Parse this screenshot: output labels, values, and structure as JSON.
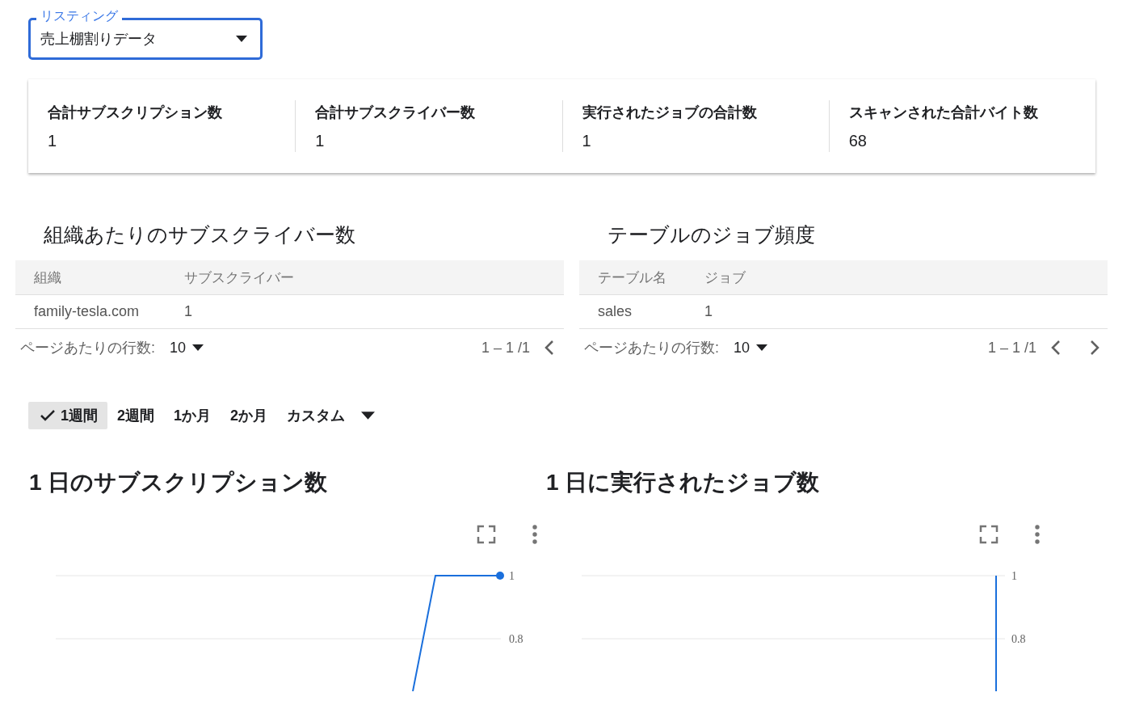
{
  "listing": {
    "label": "リスティング",
    "value": "売上棚割りデータ"
  },
  "summary": [
    {
      "label": "合計サブスクリプション数",
      "value": "1"
    },
    {
      "label": "合計サブスクライバー数",
      "value": "1"
    },
    {
      "label": "実行されたジョブの合計数",
      "value": "1"
    },
    {
      "label": "スキャンされた合計バイト数",
      "value": "68"
    }
  ],
  "tables": [
    {
      "title": "組織あたりのサブスクライバー数",
      "columns": [
        "組織",
        "サブスクライバー"
      ],
      "rows": [
        [
          "family-tesla.com",
          "1"
        ]
      ],
      "paginator": {
        "label": "ページあたりの行数:",
        "page_size": "10",
        "range": "1 – 1 /1",
        "prev_button": true,
        "next_button": false
      }
    },
    {
      "title": "テーブルのジョブ頻度",
      "columns": [
        "テーブル名",
        "ジョブ"
      ],
      "rows": [
        [
          "sales",
          "1"
        ]
      ],
      "paginator": {
        "label": "ページあたりの行数:",
        "page_size": "10",
        "range": "1 – 1 /1",
        "prev_button": true,
        "next_button": true
      }
    }
  ],
  "periods": [
    {
      "label": "1週間",
      "selected": true,
      "kind": "chip"
    },
    {
      "label": "2週間",
      "selected": false,
      "kind": "chip"
    },
    {
      "label": "1か月",
      "selected": false,
      "kind": "chip"
    },
    {
      "label": "2か月",
      "selected": false,
      "kind": "chip"
    },
    {
      "label": "カスタム",
      "selected": false,
      "kind": "dropdown"
    }
  ],
  "charts": [
    {
      "title": "1 日のサブスクリプション数",
      "kind": "step",
      "axis_labels": [
        "1",
        "0.8"
      ]
    },
    {
      "title": "1 日に実行されたジョブ数",
      "kind": "spike",
      "axis_labels": [
        "1",
        "0.8"
      ]
    }
  ]
}
